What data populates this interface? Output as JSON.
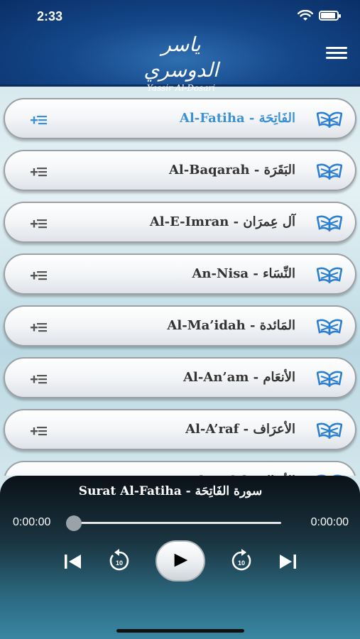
{
  "status": {
    "time": "2:33"
  },
  "header": {
    "logo_arabic": "ياسر الدوسري",
    "logo_english": "Yassir Al-Dosari"
  },
  "surahs": [
    {
      "title": "Al-Fatiha - الفَاتِحَة",
      "active": true
    },
    {
      "title": "Al-Baqarah - البَقَرَة",
      "active": false
    },
    {
      "title": "Al-E-Imran - آل عِمرَان",
      "active": false
    },
    {
      "title": "An-Nisa - النِّسَاء",
      "active": false
    },
    {
      "title": "Al-Ma’idah - المَائدة",
      "active": false
    },
    {
      "title": "Al-An’am - الأنعَام",
      "active": false
    },
    {
      "title": "Al-A’raf - الأعرَاف",
      "active": false
    },
    {
      "title": "Al-Anfal - الأنفَال",
      "active": false
    }
  ],
  "player": {
    "now_playing": "Surat Al-Fatiha - سورة الفَاتِحَة",
    "elapsed": "0:00:00",
    "duration": "0:00:00",
    "progress": 0,
    "skip_seconds": "10"
  },
  "colors": {
    "active_title": "#3b92d6",
    "inactive_title": "#333333",
    "icon_blue": "#2a7fd0",
    "header_blue": "#14478a"
  }
}
